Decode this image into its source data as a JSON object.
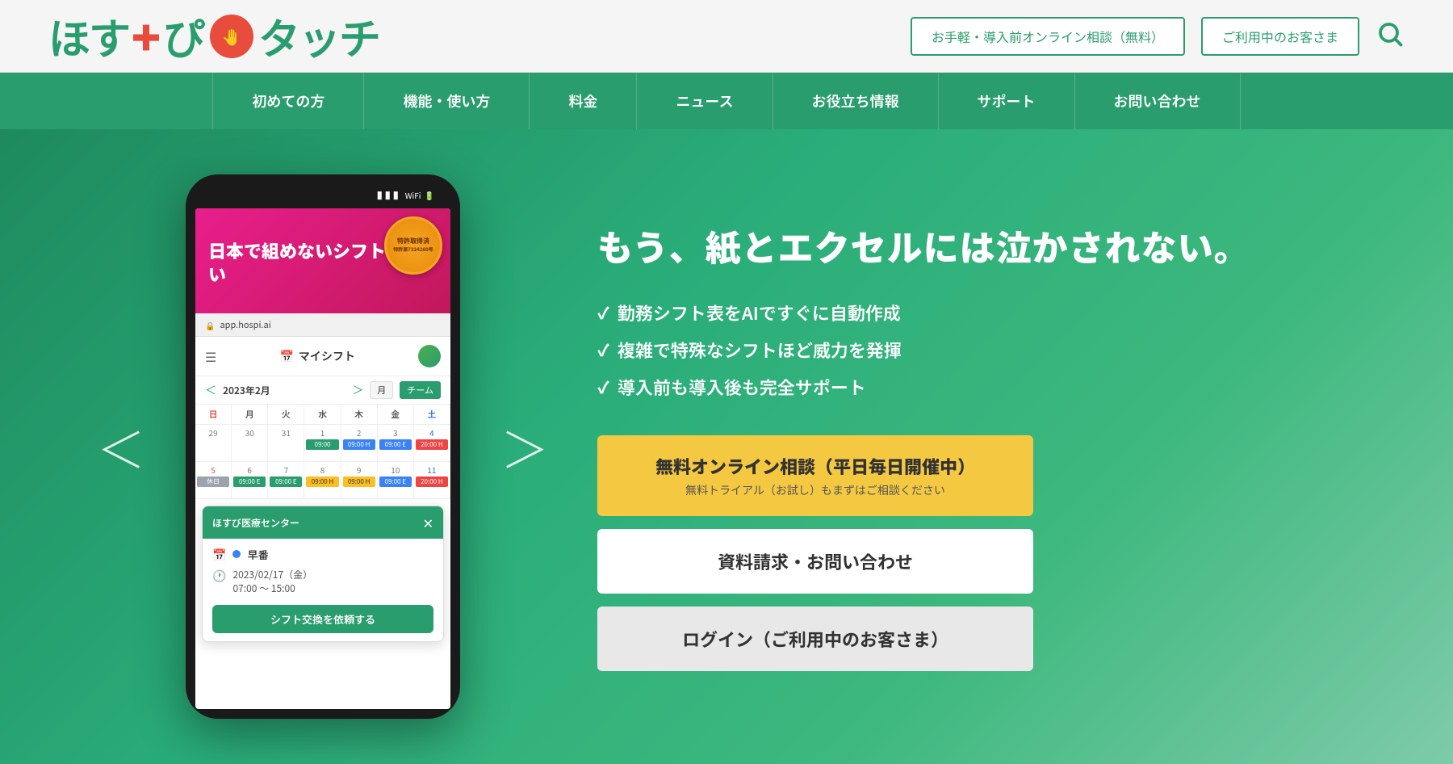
{
  "header": {
    "logo_text": "ほすぴタッチ",
    "logo_part1": "ほす",
    "logo_cross": "✚",
    "logo_part2": "ぴ",
    "logo_touch": "タッチ",
    "btn_consultation": "お手軽・導入前オンライン相談（無料）",
    "btn_customer": "ご利用中のお客さま",
    "search_label": "search"
  },
  "nav": {
    "items": [
      {
        "label": "初めての方"
      },
      {
        "label": "機能・使い方"
      },
      {
        "label": "料金"
      },
      {
        "label": "ニュース"
      },
      {
        "label": "お役立ち情報"
      },
      {
        "label": "サポート"
      },
      {
        "label": "お問い合わせ"
      }
    ]
  },
  "hero": {
    "phone": {
      "banner_text": "日本で組めないシフトは無い",
      "patent_line1": "特許取得済",
      "patent_line2": "特許第7324260号",
      "address": "app.hospi.ai",
      "app_title": "マイシフト",
      "date_nav": "2023年2月",
      "view_month": "月",
      "view_team": "チーム",
      "days": [
        "日",
        "月",
        "火",
        "水",
        "木",
        "金",
        "土"
      ],
      "calendar_rows": [
        {
          "dates": [
            "29",
            "30",
            "31",
            "1",
            "2",
            "3",
            "4"
          ],
          "shifts": [
            "",
            "",
            "",
            "09:00",
            "09:00",
            "09:00",
            "20:00"
          ]
        },
        {
          "dates": [
            "5",
            "6",
            "7",
            "8",
            "9",
            "10",
            "11"
          ],
          "shifts": [
            "休日",
            "09:00 E",
            "09:00 E",
            "09:00 H",
            "09:00 H",
            "09:00 E",
            "20:00 H"
          ]
        }
      ],
      "popup_title": "ほすび医療センター",
      "popup_shift": "早番",
      "popup_date": "2023/02/17（金）",
      "popup_time": "07:00 ～ 15:00",
      "popup_btn": "シフト交換を依頼する"
    },
    "arrow_left": "＜",
    "arrow_right": "＞",
    "headline": "もう、紙とエクセルには泣かされない。",
    "features": [
      "勤務シフト表をAIですぐに自動作成",
      "複雑で特殊なシフトほど威力を発揮",
      "導入前も導入後も完全サポート"
    ],
    "cta_primary_main": "無料オンライン相談（平日毎日開催中）",
    "cta_primary_sub": "無料トライアル（お試し）もまずはご相談ください",
    "cta_secondary": "資料請求・お問い合わせ",
    "cta_tertiary": "ログイン（ご利用中のお客さま）"
  },
  "colors": {
    "brand_green": "#2a9d6e",
    "brand_pink": "#e91e8c",
    "cta_yellow": "#f5c842"
  }
}
